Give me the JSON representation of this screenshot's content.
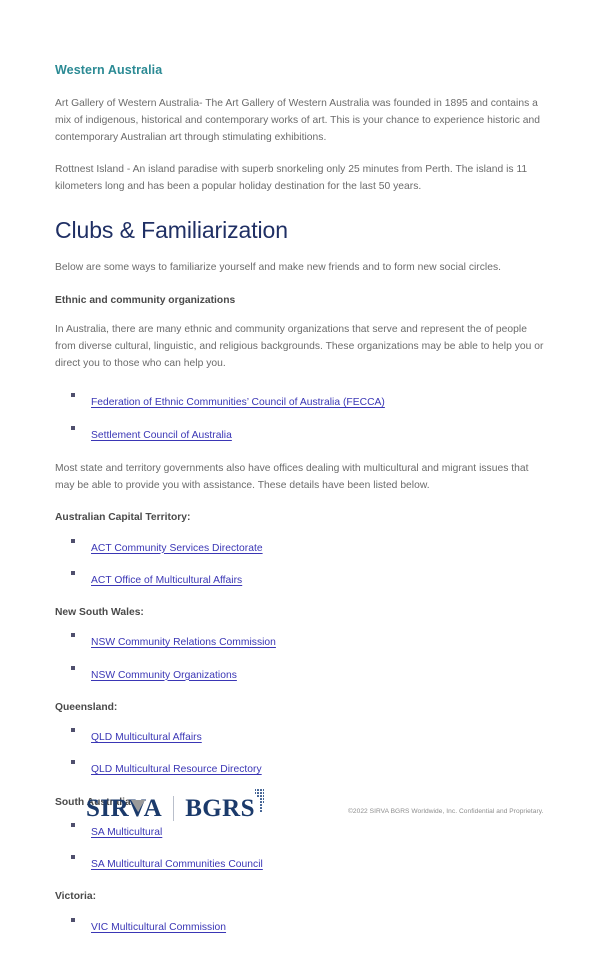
{
  "document": {
    "section_heading": "Western Australia",
    "paragraphs": [
      "Art Gallery of Western Australia- The Art Gallery of Western Australia was founded in 1895 and contains a mix of indigenous, historical and contemporary works of art. This is your chance to experience historic and contemporary Australian art through stimulating exhibitions.",
      "Rottnest Island - An island paradise with superb snorkeling only 25 minutes from Perth. The island is 11 kilometers long and has been a popular holiday destination for the last 50 years."
    ],
    "title": "Clubs & Familiarization",
    "intro": "Below are some ways to familiarize yourself and make new friends and to form new social circles.",
    "subheading": "Ethnic and community organizations",
    "body_1": "In Australia, there are many ethnic and community organizations that serve and represent the  of people from diverse cultural, linguistic, and religious backgrounds. These organizations may be able to help you or direct you to those who can help you.",
    "national_links": [
      "Federation of Ethnic Communities’ Council of Australia (FECCA)",
      "Settlement Council of Australia"
    ],
    "body_2": "Most state and territory governments also have offices dealing with multicultural and migrant issues that may be able to provide you with assistance. These details have been listed below.",
    "states": [
      {
        "name": "Australian Capital Territory:",
        "links": [
          "ACT Community Services Directorate",
          "ACT Office of Multicultural Affairs"
        ]
      },
      {
        "name": "New South Wales:",
        "links": [
          "NSW Community Relations Commission ",
          "NSW Community Organizations "
        ]
      },
      {
        "name": "Queensland:",
        "links": [
          "QLD Multicultural Affairs",
          "QLD Multicultural Resource Directory"
        ]
      },
      {
        "name": "South Australia:",
        "links": [
          "SA Multicultural",
          "SA Multicultural Communities Council"
        ]
      },
      {
        "name": "Victoria:",
        "links": [
          "VIC Multicultural Commission"
        ]
      }
    ]
  },
  "footer": {
    "logo_left": "SIRVA",
    "logo_right": "BGRS",
    "copyright": "©2022 SIRVA BGRS Worldwide, Inc. Confidential and Proprietary."
  },
  "colors": {
    "section_heading": "#2b8a94",
    "title": "#1f2f64",
    "link": "#3a36b5",
    "body_text": "#6b6b6b",
    "logo_navy": "#1b3a6b"
  }
}
